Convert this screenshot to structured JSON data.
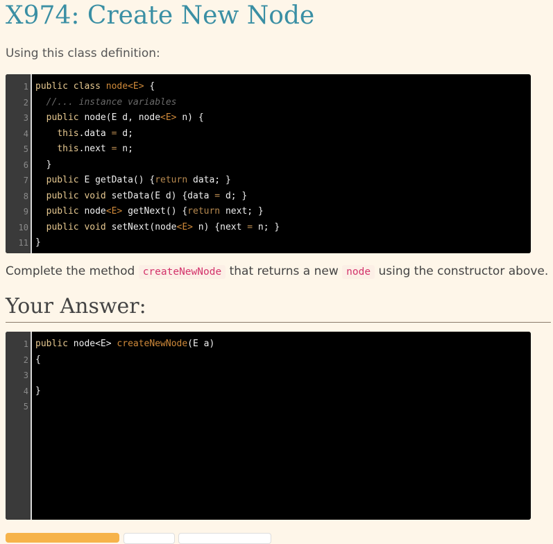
{
  "page": {
    "title": "X974: Create New Node",
    "prompt": "Using this class definition:",
    "question_before": "Complete the method",
    "question_method": "createNewNode",
    "question_middle": "that returns a new",
    "question_type": "node",
    "question_after": "using the constructor above.",
    "answer_heading": "Your Answer:"
  },
  "class_code": {
    "line_numbers": [
      "1",
      "2",
      "3",
      "4",
      "5",
      "6",
      "7",
      "8",
      "9",
      "10",
      "11"
    ]
  },
  "answer_code": {
    "line_numbers": [
      "1",
      "2",
      "3",
      "4",
      "5"
    ],
    "line_1_kw": "public ",
    "line_1_type": "node<E> ",
    "line_1_name": "createNewNode",
    "line_1_rest": "(E a)",
    "line_2": "{",
    "line_4": "}"
  },
  "colors": {
    "title": "#3a8fa4",
    "background": "#fef6e9",
    "code_background": "#000000",
    "inline_code": "#d3336b",
    "primary_button": "#f6b34a"
  }
}
